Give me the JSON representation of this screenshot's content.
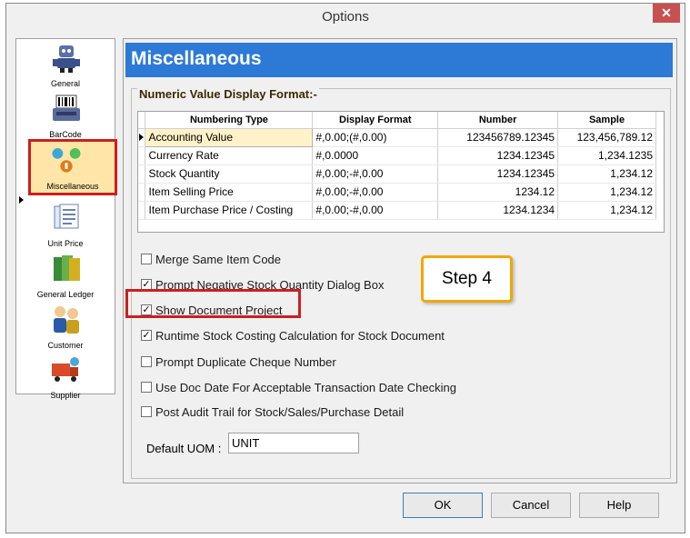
{
  "window": {
    "title": "Options",
    "close_glyph": "✕"
  },
  "sidebar": {
    "items": [
      {
        "label": "General",
        "icon": "robot-icon"
      },
      {
        "label": "BarCode",
        "icon": "barcode-printer-icon"
      },
      {
        "label": "Miscellaneous",
        "icon": "misc-spheres-icon"
      },
      {
        "label": "Unit Price",
        "icon": "documents-icon"
      },
      {
        "label": "General Ledger",
        "icon": "ledger-books-icon"
      },
      {
        "label": "Customer",
        "icon": "customer-people-icon"
      },
      {
        "label": "Supplier",
        "icon": "supplier-truck-icon"
      }
    ]
  },
  "panel": {
    "header": "Miscellaneous",
    "group_title": "Numeric Value Display Format:-",
    "grid": {
      "columns": [
        "Numbering Type",
        "Display Format",
        "Number",
        "Sample"
      ],
      "rows": [
        [
          "Accounting Value",
          "#,0.00;(#,0.00)",
          "123456789.12345",
          "123,456,789.12"
        ],
        [
          "Currency Rate",
          "#,0.0000",
          "1234.12345",
          "1,234.1235"
        ],
        [
          "Stock Quantity",
          "#,0.00;-#,0.00",
          "1234.12345",
          "1,234.12"
        ],
        [
          "Item Selling Price",
          "#,0.00;-#,0.00",
          "1234.12",
          "1,234.12"
        ],
        [
          "Item Purchase Price / Costing",
          "#,0.00;-#,0.00",
          "1234.1234",
          "1,234.12"
        ]
      ]
    },
    "options": [
      {
        "label": "Merge Same Item Code",
        "checked": false
      },
      {
        "label": "Prompt Negative Stock Quantity Dialog Box",
        "checked": true
      },
      {
        "label": "Show Document Project",
        "checked": true
      },
      {
        "label": "Runtime Stock Costing Calculation for Stock Document",
        "checked": true
      },
      {
        "label": "Prompt Duplicate Cheque Number",
        "checked": false
      },
      {
        "label": "Use Doc Date For Acceptable Transaction Date Checking",
        "checked": false
      },
      {
        "label": "Post Audit Trail for Stock/Sales/Purchase Detail",
        "checked": false
      }
    ],
    "uom_label": "Default UOM :",
    "uom_value": "UNIT"
  },
  "annotation": {
    "step": "Step 4"
  },
  "buttons": {
    "ok": "OK",
    "cancel": "Cancel",
    "help": "Help"
  },
  "colors": {
    "header_bg": "#2d79d6",
    "highlight_red": "#cc1f1f",
    "step_border": "#f0a800"
  }
}
